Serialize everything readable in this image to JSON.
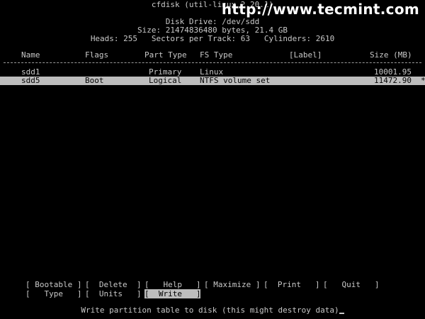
{
  "title": "cfdisk (util-linux 2.20.1)",
  "watermark": "http://www.tecmint.com",
  "disk": {
    "drive": "Disk Drive: /dev/sdd",
    "size": "Size: 21474836480 bytes, 21.4 GB",
    "geometry": "Heads: 255   Sectors per Track: 63   Cylinders: 2610"
  },
  "table": {
    "headers": [
      "Name",
      "Flags",
      "Part Type",
      "FS Type",
      "[Label]",
      "Size (MB)"
    ],
    "rows": [
      {
        "name": "sdd1",
        "flags": "",
        "part_type": "Primary",
        "fs_type": "Linux",
        "label": "",
        "size": "10001.95",
        "mark": ""
      },
      {
        "name": "sdd5",
        "flags": "Boot",
        "part_type": "Logical",
        "fs_type": "NTFS volume set",
        "label": "",
        "size": "11472.90",
        "mark": "*"
      }
    ]
  },
  "menu": {
    "bootable": "[ Bootable ]",
    "delete": "[  Delete  ]",
    "help": "[   Help   ]",
    "maximize": "[ Maximize ]",
    "print": "[  Print   ]",
    "quit": "[   Quit   ]",
    "type": "[   Type   ]",
    "units": "[  Units   ]",
    "write": "[  Write   ]"
  },
  "status": "Write partition table to disk (this might destroy data)"
}
